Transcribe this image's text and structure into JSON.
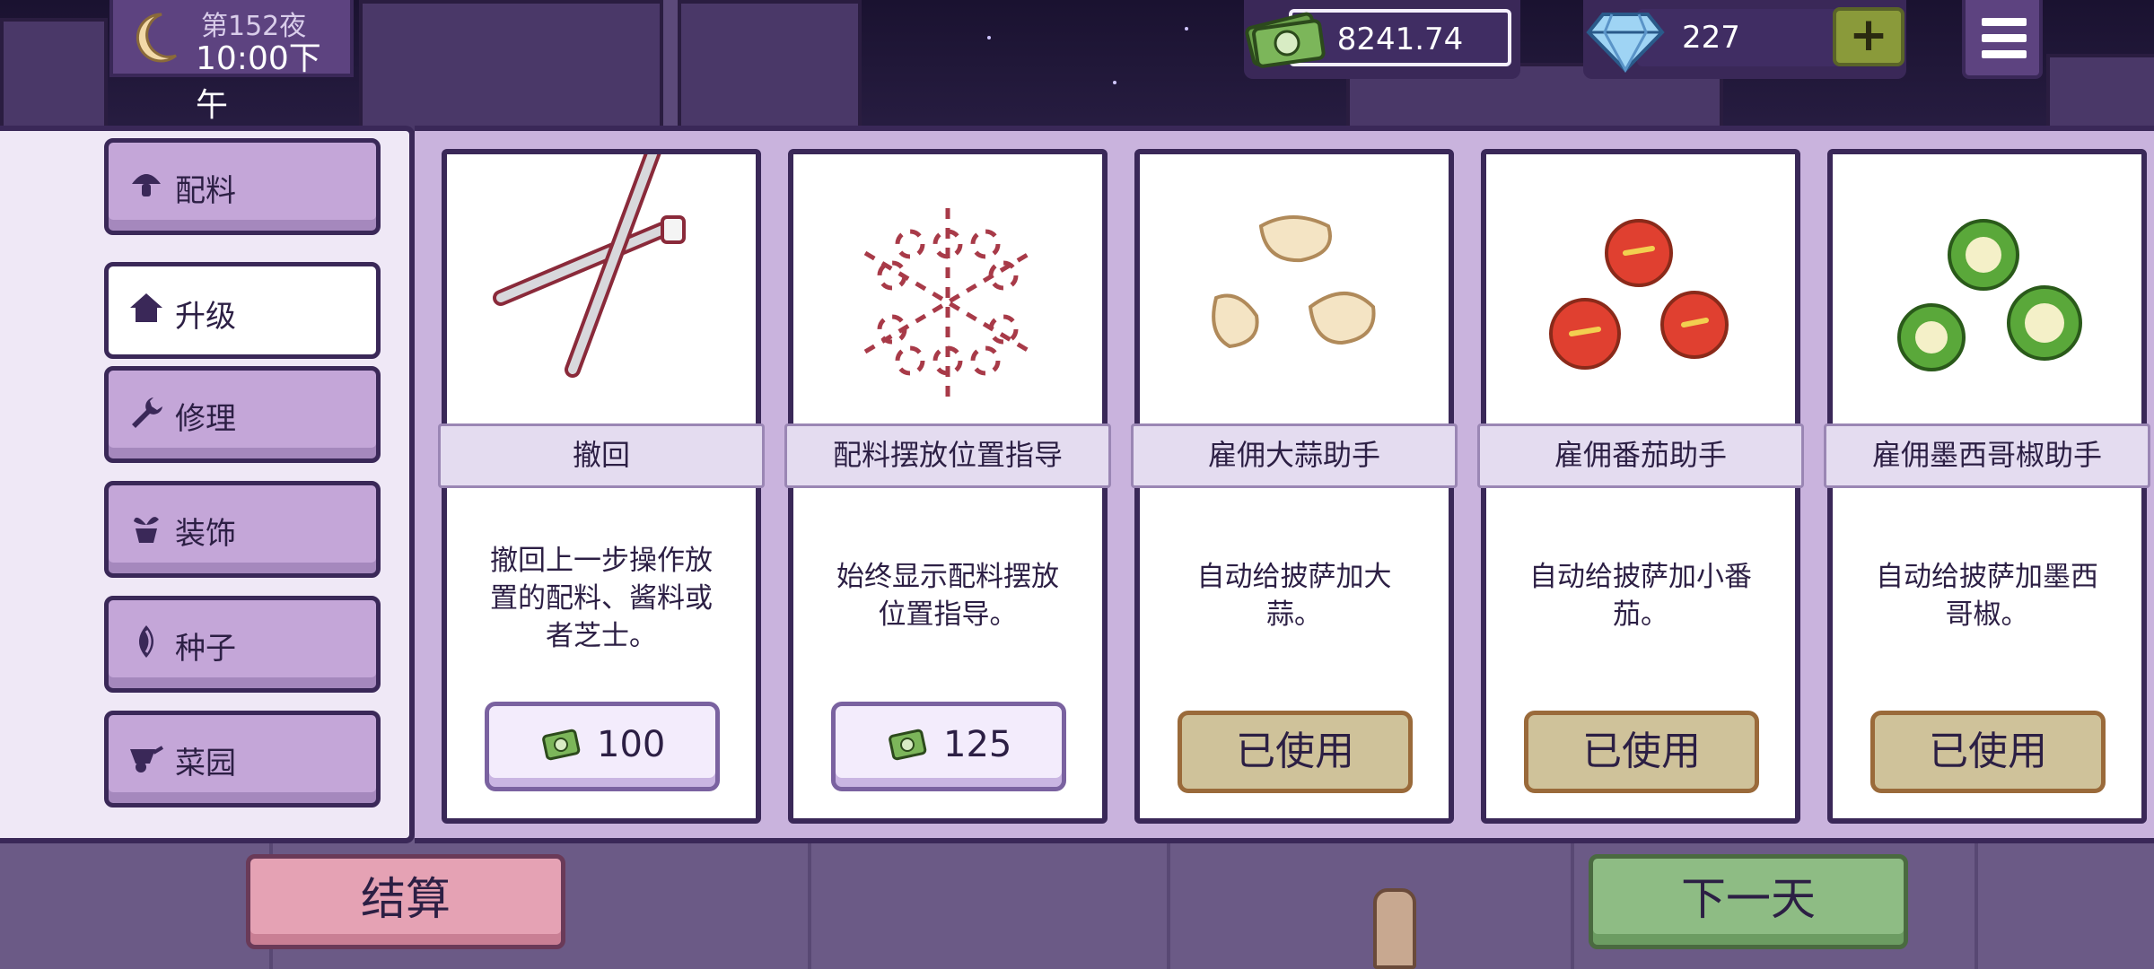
{
  "hud": {
    "day_label": "第152夜",
    "time_label": "10:00下午",
    "money": "8241.74",
    "gems": "227",
    "plus_label": "+",
    "icons": {
      "moon": "moon-icon",
      "cash": "cash-icon",
      "gem": "diamond-icon",
      "menu": "hamburger-menu-icon"
    }
  },
  "sidebar": {
    "items": [
      {
        "label": "配料",
        "icon": "mushroom-icon",
        "active": false
      },
      {
        "label": "升级",
        "icon": "house-icon",
        "active": true
      },
      {
        "label": "修理",
        "icon": "wrench-icon",
        "active": false
      },
      {
        "label": "装饰",
        "icon": "potted-plant-icon",
        "active": false
      },
      {
        "label": "种子",
        "icon": "seed-icon",
        "active": false
      },
      {
        "label": "菜园",
        "icon": "wheelbarrow-icon",
        "active": false
      }
    ]
  },
  "cards": [
    {
      "title": "撤回",
      "description": "撤回上一步操作放置的配料、酱料或者芝士。",
      "price": "100",
      "status": "buy",
      "art": "tongs-icon"
    },
    {
      "title": "配料摆放位置指导",
      "description": "始终显示配料摆放位置指导。",
      "price": "125",
      "status": "buy",
      "art": "placement-guide-icon"
    },
    {
      "title": "雇佣大蒜助手",
      "description": "自动给披萨加大蒜。",
      "status_label": "已使用",
      "status": "used",
      "art": "garlic-icon"
    },
    {
      "title": "雇佣番茄助手",
      "description": "自动给披萨加小番茄。",
      "status_label": "已使用",
      "status": "used",
      "art": "tomato-icon"
    },
    {
      "title": "雇佣墨西哥椒助手",
      "description": "自动给披萨加墨西哥椒。",
      "status_label": "已使用",
      "status": "used",
      "art": "jalapeno-icon"
    }
  ],
  "footer": {
    "settle_label": "结算",
    "next_day_label": "下一天"
  },
  "colors": {
    "panel_border": "#3a2858",
    "button_purple": "#c4a6d8",
    "settle_pink": "#e5a2b4",
    "next_green": "#8ebc84",
    "used_khaki": "#cfc29a"
  }
}
